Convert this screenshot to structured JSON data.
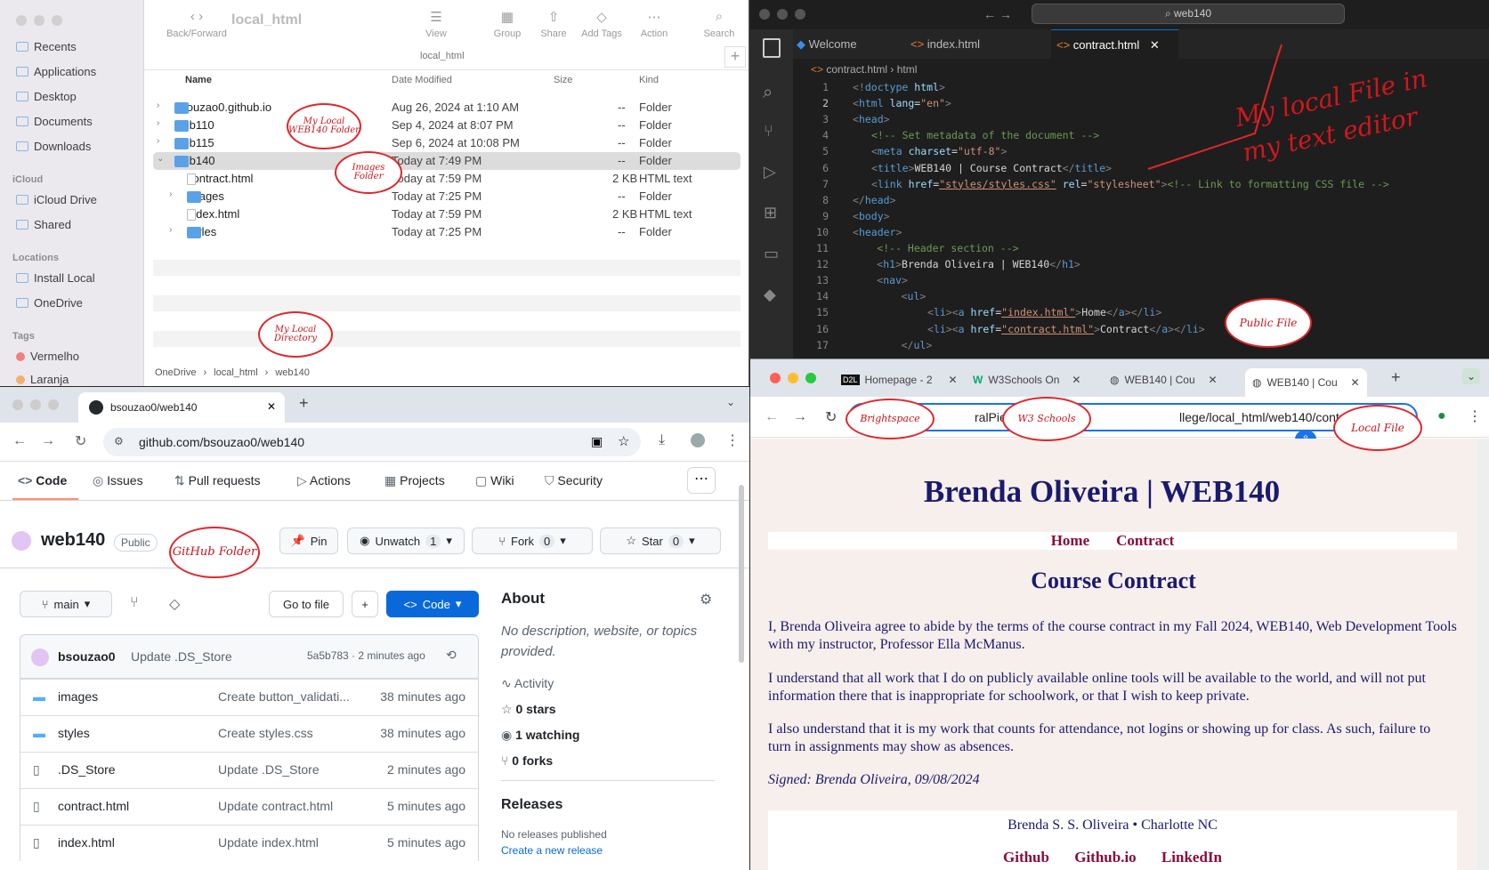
{
  "finder": {
    "title": "local_html",
    "path_label": "local_html",
    "toolbar": {
      "back": "Back/Forward",
      "view": "View",
      "group": "Group",
      "share": "Share",
      "tags": "Add Tags",
      "action": "Action",
      "search": "Search"
    },
    "sidebar": {
      "recents": "Recents",
      "applications": "Applications",
      "desktop": "Desktop",
      "documents": "Documents",
      "downloads": "Downloads",
      "icloud_header": "iCloud",
      "icloud_drive": "iCloud Drive",
      "shared": "Shared",
      "locations_header": "Locations",
      "install_local": "Install Local",
      "onedrive": "OneDrive",
      "tags_header": "Tags",
      "tag1": "Vermelho",
      "tag2": "Laranja"
    },
    "columns": {
      "name": "Name",
      "date": "Date Modified",
      "size": "Size",
      "kind": "Kind"
    },
    "rows": [
      {
        "name": "bsouzao0.github.io",
        "date": "Aug 26, 2024 at 1:10 AM",
        "size": "--",
        "kind": "Folder"
      },
      {
        "name": "web110",
        "date": "Sep 4, 2024 at 8:07 PM",
        "size": "--",
        "kind": "Folder"
      },
      {
        "name": "web115",
        "date": "Sep 6, 2024 at 10:08 PM",
        "size": "--",
        "kind": "Folder"
      },
      {
        "name": "web140",
        "date": "Today at 7:49 PM",
        "size": "--",
        "kind": "Folder"
      },
      {
        "name": "contract.html",
        "date": "Today at 7:59 PM",
        "size": "2 KB",
        "kind": "HTML text"
      },
      {
        "name": "images",
        "date": "Today at 7:25 PM",
        "size": "--",
        "kind": "Folder"
      },
      {
        "name": "index.html",
        "date": "Today at 7:59 PM",
        "size": "2 KB",
        "kind": "HTML text"
      },
      {
        "name": "styles",
        "date": "Today at 7:25 PM",
        "size": "--",
        "kind": "Folder"
      }
    ],
    "breadcrumb": [
      "OneDrive",
      "local_html",
      "web140"
    ]
  },
  "vscode": {
    "search": "web140",
    "tabs": [
      "Welcome",
      "index.html",
      "contract.html"
    ],
    "breadcrumb": [
      "contract.html",
      "html"
    ],
    "lines": [
      "1",
      "2",
      "3",
      "4",
      "5",
      "6",
      "7",
      "8",
      "9",
      "10",
      "11",
      "12",
      "13",
      "14",
      "15",
      "16",
      "17"
    ]
  },
  "github": {
    "tab_title": "bsouzao0/web140",
    "url": "github.com/bsouzao0/web140",
    "nav": [
      "Code",
      "Issues",
      "Pull requests",
      "Actions",
      "Projects",
      "Wiki",
      "Security"
    ],
    "repo": "web140",
    "visibility": "Public",
    "pin": "Pin",
    "unwatch": "Unwatch",
    "watch_count": "1",
    "fork": "Fork",
    "fork_count": "0",
    "star": "Star",
    "star_count": "0",
    "branch": "main",
    "goto": "Go to file",
    "code_btn": "Code",
    "commit_user": "bsouzao0",
    "commit_msg": "Update .DS_Store",
    "commit_hash": "5a5b783 · 2 minutes ago",
    "files": [
      {
        "name": "images",
        "msg": "Create button_validati...",
        "time": "38 minutes ago"
      },
      {
        "name": "styles",
        "msg": "Create styles.css",
        "time": "38 minutes ago"
      },
      {
        "name": ".DS_Store",
        "msg": "Update .DS_Store",
        "time": "2 minutes ago"
      },
      {
        "name": "contract.html",
        "msg": "Update contract.html",
        "time": "5 minutes ago"
      },
      {
        "name": "index.html",
        "msg": "Update index.html",
        "time": "5 minutes ago"
      }
    ],
    "about_title": "About",
    "about_desc": "No description, website, or topics provided.",
    "activity": "Activity",
    "stars": "0 stars",
    "watching": "1 watching",
    "forks": "0 forks",
    "releases": "Releases",
    "no_releases": "No releases published",
    "create_release": "Create a new release"
  },
  "chrome": {
    "tabs": [
      "Homepage - 2",
      "W3Schools On",
      "WEB140 | Cou",
      "WEB140 | Cou"
    ],
    "url": "ralPiedmon",
    "url_tail": "llege/local_html/web140/contract.html",
    "page": {
      "h1": "Brenda Oliveira | WEB140",
      "nav": [
        "Home",
        "Contract"
      ],
      "h2": "Course Contract",
      "p1": "I, Brenda Oliveira agree to abide by the terms of the course contract in my Fall 2024, WEB140, Web Development Tools with my instructor, Professor Ella McManus.",
      "p2": "I understand that all work that I do on publicly available online tools will be available to the world, and will not put information there that is inappropriate for schoolwork, or that I wish to keep private.",
      "p3": "I also understand that it is my work that counts for attendance, not logins or showing up for class. As such, failure to turn in assignments may show as absences.",
      "signed": "Signed: Brenda Oliveira, 09/08/2024",
      "footer": "Brenda S. S. Oliveira • Charlotte NC",
      "links": [
        "Github",
        "Github.io",
        "LinkedIn"
      ]
    }
  },
  "annotations": {
    "local_web140": "My Local WEB140 Folder",
    "images_folder": "Images Folder",
    "local_dir": "My Local Directory",
    "text_editor": "My local File in my text editor",
    "public_file": "Public File",
    "github_folder": "GitHub Folder",
    "brightspace": "Brightspace",
    "w3": "W3 Schools",
    "local_file": "Local File"
  },
  "colors": {
    "accent_blue": "#0969da",
    "code_green": "#1f6feb",
    "page_navy": "#1a1a6e",
    "page_link": "#8b0a3a",
    "callout_red": "#e0262a"
  }
}
